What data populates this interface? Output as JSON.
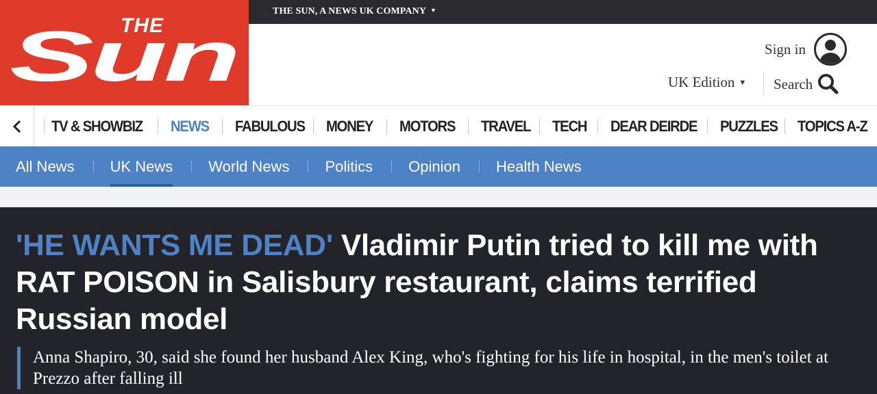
{
  "brand": {
    "logo_text_small": "THE",
    "logo_text_large": "Sun",
    "logo_bg_color": "#e03a2a"
  },
  "topbar": {
    "company_link": "THE SUN, A NEWS UK COMPANY",
    "caret_icon": "caret-down-icon"
  },
  "header": {
    "signin_label": "Sign in",
    "edition_label": "UK Edition",
    "search_label": "Search"
  },
  "main_nav": {
    "back_icon": "chevron-left-icon",
    "items": [
      {
        "label": "TV & SHOWBIZ",
        "active": false
      },
      {
        "label": "NEWS",
        "active": true
      },
      {
        "label": "FABULOUS",
        "active": false
      },
      {
        "label": "MONEY",
        "active": false
      },
      {
        "label": "MOTORS",
        "active": false
      },
      {
        "label": "TRAVEL",
        "active": false
      },
      {
        "label": "TECH",
        "active": false
      },
      {
        "label": "DEAR DEIRDE",
        "active": false
      },
      {
        "label": "PUZZLES",
        "active": false
      },
      {
        "label": "TOPICS A-Z",
        "active": false
      }
    ]
  },
  "sub_nav": {
    "items": [
      {
        "label": "All News",
        "active": false
      },
      {
        "label": "UK News",
        "active": true
      },
      {
        "label": "World News",
        "active": false
      },
      {
        "label": "Politics",
        "active": false
      },
      {
        "label": "Opinion",
        "active": false
      },
      {
        "label": "Health News",
        "active": false
      }
    ]
  },
  "article": {
    "kicker": "'HE WANTS ME DEAD'",
    "headline": "Vladimir Putin tried to kill me with RAT POISON in Salisbury restaurant, claims terrified Russian model",
    "standfirst": "Anna Shapiro, 30, said she found her husband Alex King, who's fighting for his life in hospital, in the men's toilet at Prezzo after falling ill"
  },
  "colors": {
    "accent_blue": "#4d82c6",
    "dark_band": "#23232a",
    "topbar": "#2b2b2f"
  }
}
